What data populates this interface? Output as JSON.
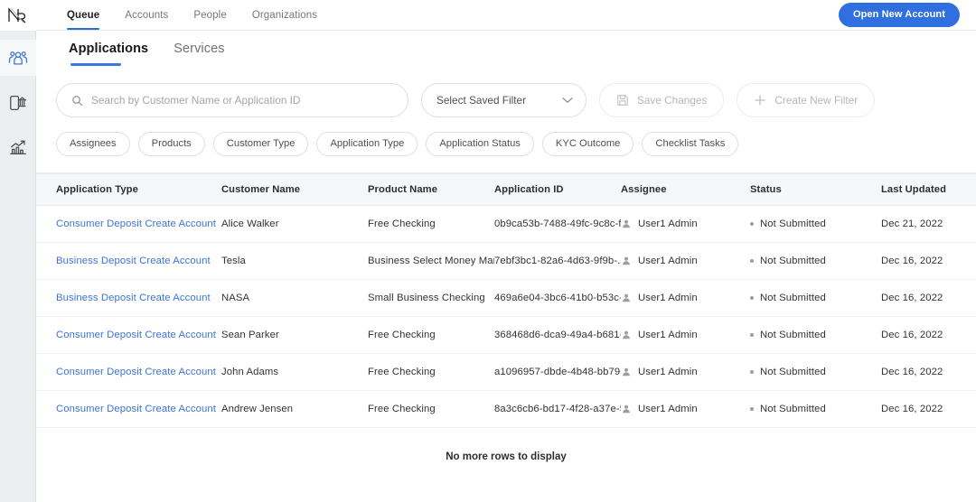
{
  "rail": {
    "logo_label": "NR",
    "items": [
      {
        "name": "people-icon",
        "label": "People",
        "active": true
      },
      {
        "name": "mobile-bank-icon",
        "label": "Banking",
        "active": false
      },
      {
        "name": "analytics-icon",
        "label": "Analytics",
        "active": false
      }
    ]
  },
  "topnav": {
    "tabs": [
      {
        "label": "Queue",
        "active": true
      },
      {
        "label": "Accounts",
        "active": false
      },
      {
        "label": "People",
        "active": false
      },
      {
        "label": "Organizations",
        "active": false
      }
    ],
    "primary_button": "Open New Account"
  },
  "subtabs": [
    {
      "label": "Applications",
      "active": true
    },
    {
      "label": "Services",
      "active": false
    }
  ],
  "filters": {
    "search": {
      "placeholder": "Search by Customer Name or Application ID",
      "value": ""
    },
    "saved_filter": {
      "label": "Select Saved Filter"
    },
    "save_changes": "Save Changes",
    "create_new_filter": "Create New Filter",
    "chips": [
      "Assignees",
      "Products",
      "Customer Type",
      "Application Type",
      "Application Status",
      "KYC Outcome",
      "Checklist Tasks"
    ]
  },
  "table": {
    "columns": [
      "Application Type",
      "Customer Name",
      "Product Name",
      "Application ID",
      "Assignee",
      "Status",
      "Last Updated"
    ],
    "rows": [
      {
        "application_type": "Consumer Deposit Create Account",
        "customer_name": "Alice Walker",
        "product_name": "Free Checking",
        "application_id": "0b9ca53b-7488-49fc-9c8c-f...",
        "assignee": "User1 Admin",
        "status": "Not Submitted",
        "last_updated": "Dec 21, 2022"
      },
      {
        "application_type": "Business Deposit Create Account",
        "customer_name": "Tesla",
        "product_name": "Business Select Money Mar...",
        "application_id": "7ebf3bc1-82a6-4d63-9f9b-...",
        "assignee": "User1 Admin",
        "status": "Not Submitted",
        "last_updated": "Dec 16, 2022"
      },
      {
        "application_type": "Business Deposit Create Account",
        "customer_name": "NASA",
        "product_name": "Small Business Checking",
        "application_id": "469a6e04-3bc6-41b0-b53c-...",
        "assignee": "User1 Admin",
        "status": "Not Submitted",
        "last_updated": "Dec 16, 2022"
      },
      {
        "application_type": "Consumer Deposit Create Account",
        "customer_name": "Sean Parker",
        "product_name": "Free Checking",
        "application_id": "368468d6-dca9-49a4-b681-...",
        "assignee": "User1 Admin",
        "status": "Not Submitted",
        "last_updated": "Dec 16, 2022"
      },
      {
        "application_type": "Consumer Deposit Create Account",
        "customer_name": "John Adams",
        "product_name": "Free Checking",
        "application_id": "a1096957-dbde-4b48-bb79-...",
        "assignee": "User1 Admin",
        "status": "Not Submitted",
        "last_updated": "Dec 16, 2022"
      },
      {
        "application_type": "Consumer Deposit Create Account",
        "customer_name": "Andrew Jensen",
        "product_name": "Free Checking",
        "application_id": "8a3c6cb6-bd17-4f28-a37e-5...",
        "assignee": "User1 Admin",
        "status": "Not Submitted",
        "last_updated": "Dec 16, 2022"
      }
    ],
    "empty_message": "No more rows to display"
  },
  "colors": {
    "accent": "#2f6fe0",
    "link": "#3a74d8",
    "rail_bg": "#eceef0",
    "header_bg": "#f6f7f8",
    "status_dot": "#9a9da3"
  }
}
